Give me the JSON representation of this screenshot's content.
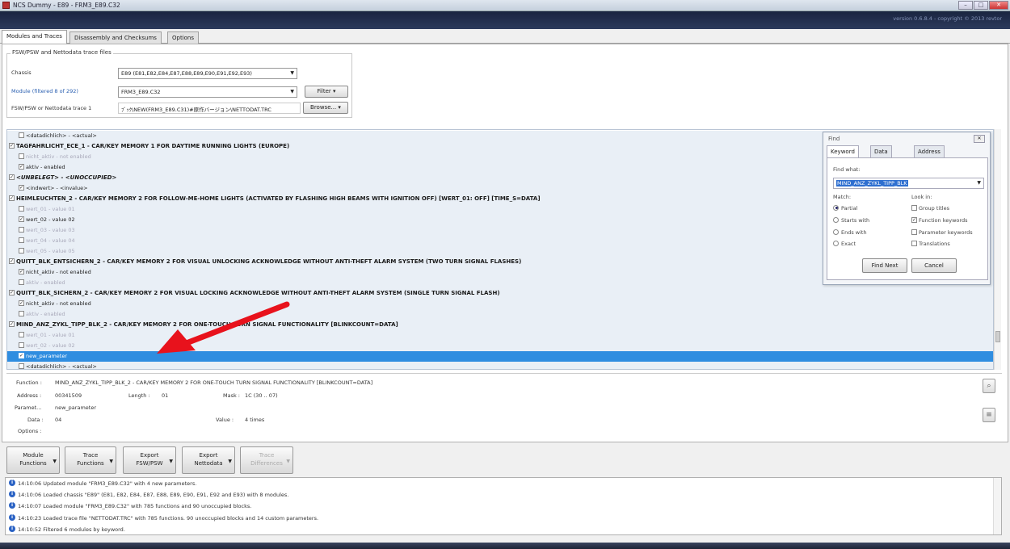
{
  "window": {
    "title": "NCS Dummy - E89 - FRM3_E89.C32",
    "version": "version 0.6.8.4 - copyright © 2013 revtor"
  },
  "tabs": [
    "Modules and Traces",
    "Disassembly and Checksums",
    "Options"
  ],
  "fsw": {
    "group_title": "FSW/PSW and Nettodata trace files",
    "chassis_label": "Chassis",
    "chassis_value": "E89 (E81,E82,E84,E87,E88,E89,E90,E91,E92,E93)",
    "module_label": "Module (filtered 8 of 292)",
    "module_value": "FRM3_E89.C32",
    "filter_label": "Filter",
    "trace_label": "FSW/PSW or Nettodata trace 1",
    "trace_value": "ﾌﾞｯｸ\\NEW(FRM3_E89.C31)#原作バージョン\\NETTODAT.TRC",
    "browse_label": "Browse..."
  },
  "tree": [
    {
      "check": "",
      "text": "<datadichlich> - <actual>",
      "style": "plain"
    },
    {
      "check": "x",
      "text": "TAGFAHRLICHT_ECE_1 - CAR/KEY MEMORY 1 FOR DAYTIME RUNNING LIGHTS (EUROPE)",
      "style": "bold"
    },
    {
      "check": "",
      "text": "nicht_aktiv - not enabled",
      "style": "grey"
    },
    {
      "check": "x",
      "text": "aktiv - enabled",
      "style": "plain"
    },
    {
      "check": "x",
      "text": "<UNBELEGT> - <UNOCCUPIED>",
      "style": "italic"
    },
    {
      "check": "x",
      "text": "<indwert> - <invalue>",
      "style": "plain"
    },
    {
      "check": "x",
      "text": "HEIMLEUCHTEN_2 - CAR/KEY MEMORY 2 FOR FOLLOW-ME-HOME LIGHTS (ACTIVATED BY FLASHING HIGH BEAMS WITH IGNITION OFF) [WERT_01: OFF] [TIME_S=DATA]",
      "style": "bold"
    },
    {
      "check": "",
      "text": "wert_01 - value 01",
      "style": "grey"
    },
    {
      "check": "x",
      "text": "wert_02 - value 02",
      "style": "plain"
    },
    {
      "check": "",
      "text": "wert_03 - value 03",
      "style": "grey"
    },
    {
      "check": "",
      "text": "wert_04 - value 04",
      "style": "grey"
    },
    {
      "check": "",
      "text": "wert_05 - value 05",
      "style": "grey"
    },
    {
      "check": "x",
      "text": "QUITT_BLK_ENTSICHERN_2 - CAR/KEY MEMORY 2 FOR VISUAL UNLOCKING ACKNOWLEDGE WITHOUT ANTI-THEFT ALARM SYSTEM (TWO TURN SIGNAL FLASHES)",
      "style": "bold"
    },
    {
      "check": "x",
      "text": "nicht_aktiv - not enabled",
      "style": "plain"
    },
    {
      "check": "",
      "text": "aktiv - enabled",
      "style": "grey"
    },
    {
      "check": "x",
      "text": "QUITT_BLK_SICHERN_2 - CAR/KEY MEMORY 2 FOR VISUAL LOCKING ACKNOWLEDGE WITHOUT ANTI-THEFT ALARM SYSTEM (SINGLE TURN SIGNAL FLASH)",
      "style": "bold"
    },
    {
      "check": "x",
      "text": "nicht_aktiv - not enabled",
      "style": "plain"
    },
    {
      "check": "",
      "text": "aktiv - enabled",
      "style": "grey"
    },
    {
      "check": "x",
      "text": "MIND_ANZ_ZYKL_TIPP_BLK_2 - CAR/KEY MEMORY 2 FOR ONE-TOUCH TURN SIGNAL FUNCTIONALITY [BLINKCOUNT=DATA]",
      "style": "bold"
    },
    {
      "check": "",
      "text": "wert_01 - value 01",
      "style": "grey"
    },
    {
      "check": "",
      "text": "wert_02 - value 02",
      "style": "grey"
    },
    {
      "check": "x",
      "text": "new_parameter",
      "style": "sel"
    },
    {
      "check": "",
      "text": "<datadichlich> - <actual>",
      "style": "plain"
    }
  ],
  "find": {
    "title": "Find",
    "tabs": [
      "Keyword",
      "Data",
      "Address"
    ],
    "find_what_label": "Find what:",
    "find_what_value": "MIND_ANZ_ZYKL_TIPP_BLK",
    "match_label": "Match:",
    "match_options": [
      "Partial",
      "Starts with",
      "Ends with",
      "Exact"
    ],
    "lookin_label": "Look in:",
    "lookin_options": [
      "Group titles",
      "Function keywords",
      "Parameter keywords",
      "Translations"
    ],
    "find_next": "Find Next",
    "cancel": "Cancel"
  },
  "details": {
    "function_label": "Function :",
    "function_value": "MIND_ANZ_ZYKL_TIPP_BLK_2 - CAR/KEY MEMORY 2 FOR ONE-TOUCH TURN SIGNAL FUNCTIONALITY [BLINKCOUNT=DATA]",
    "address_label": "Address :",
    "address_value": "00341509",
    "length_label": "Length :",
    "length_value": "01",
    "mask_label": "Mask :",
    "mask_value": "1C (30 .. 07)",
    "param_label": "Paramet...",
    "param_value": "new_parameter",
    "data_label": "Data :",
    "data_value": "04",
    "value_label": "Value :",
    "value_value": "4 times",
    "options_label": "Options :"
  },
  "toolbar": [
    {
      "line1": "Module",
      "line2": "Functions"
    },
    {
      "line1": "Trace",
      "line2": "Functions"
    },
    {
      "line1": "Export",
      "line2": "FSW/PSW"
    },
    {
      "line1": "Export",
      "line2": "Nettodata"
    },
    {
      "line1": "Trace",
      "line2": "Differences"
    }
  ],
  "log": [
    "14:10:06 Updated module \"FRM3_E89.C32\" with 4 new parameters.",
    "14:10:06 Loaded chassis \"E89\" (E81, E82, E84, E87, E88, E89, E90, E91, E92 and E93) with 8 modules.",
    "14:10:07 Loaded module \"FRM3_E89.C32\" with 785 functions and 90 unoccupied blocks.",
    "14:10:23 Loaded trace file \"NETTODAT.TRC\" with 785 functions. 90 unoccupied blocks and 14 custom parameters.",
    "14:10:52 Filtered 6 modules by keyword."
  ]
}
